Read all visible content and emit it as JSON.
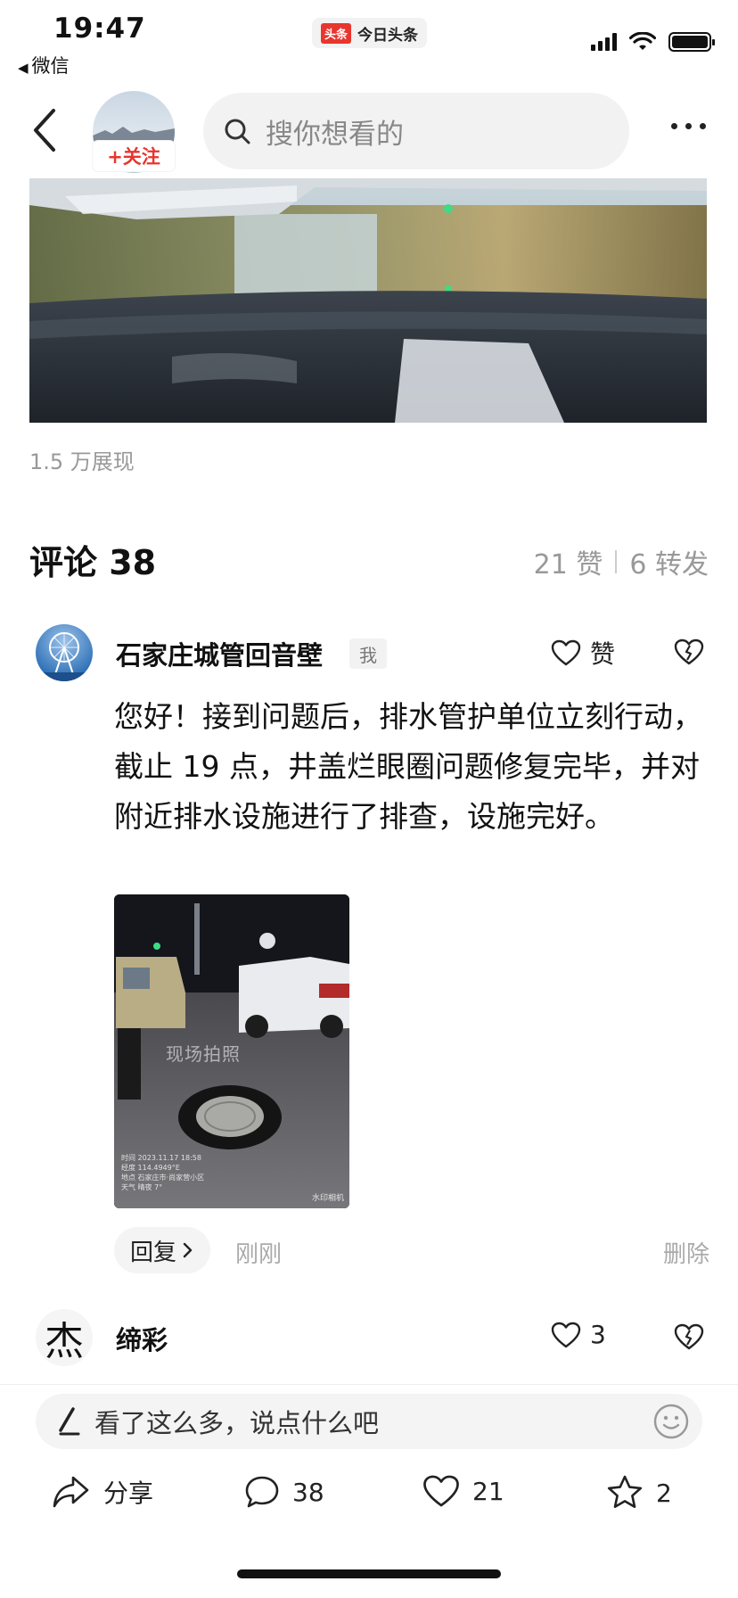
{
  "status_bar": {
    "time": "19:47",
    "back_app": "微信",
    "center_logo": "头条",
    "center_app": "今日头条"
  },
  "nav": {
    "follow_label": "+关注",
    "search_placeholder": "搜你想看的"
  },
  "post": {
    "views": "1.5 万展现"
  },
  "comments_header": {
    "title": "评论 38",
    "likes": "21 赞",
    "shares": "6 转发"
  },
  "comments": [
    {
      "author": "石家庄城管回音壁",
      "badge": "我",
      "like_label": "赞",
      "text": "您好！接到问题后，排水管护单位立刻行动，截止 19 点，井盖烂眼圈问题修复完毕，并对附近排水设施进行了排查，设施完好。",
      "image": {
        "watermark": "现场拍照",
        "info_lines": [
          "时间 2023.11.17 18:58",
          "经度 114.4949°E",
          "地点 石家庄市·尚家营小区",
          "天气 晴夜 7°"
        ],
        "brand": "水印相机"
      },
      "reply_label": "回复",
      "time": "刚刚",
      "delete_label": "删除"
    },
    {
      "author": "缔彩",
      "avatar_char": "杰",
      "like_count": "3"
    }
  ],
  "bottom_bar": {
    "input_placeholder": "看了这么多，说点什么吧",
    "share_label": "分享",
    "comment_count": "38",
    "like_count": "21",
    "favorite_count": "2"
  },
  "colors": {
    "accent": "#e8352e",
    "muted_text": "#999999",
    "pill_bg": "#f2f2f2"
  }
}
